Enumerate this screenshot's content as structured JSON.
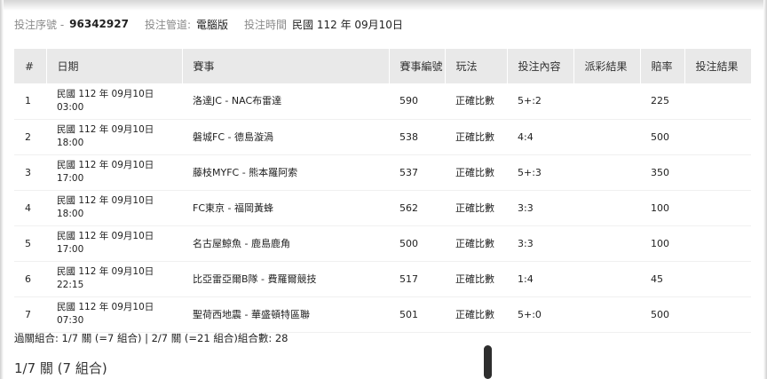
{
  "info": {
    "serial_label": "投注序號 -",
    "serial_value": "96342927",
    "channel_label": "投注管道:",
    "channel_value": "電腦版",
    "time_label": "投注時間",
    "time_value": "民國 112 年 09月10日"
  },
  "table": {
    "headers": [
      "#",
      "日期",
      "賽事",
      "賽事編號",
      "玩法",
      "投注內容",
      "派彩結果",
      "賠率",
      "投注結果"
    ],
    "rows": [
      {
        "no": "1",
        "date": "民國 112 年 09月10日",
        "time": "03:00",
        "match": "洛達JC - NAC布雷達",
        "match_id": "590",
        "play": "正確比數",
        "pick": "5+:2",
        "payout": "",
        "odds": "225",
        "result": ""
      },
      {
        "no": "2",
        "date": "民國 112 年 09月10日",
        "time": "18:00",
        "match": "磐城FC - 德島漩渦",
        "match_id": "538",
        "play": "正確比數",
        "pick": "4:4",
        "payout": "",
        "odds": "500",
        "result": ""
      },
      {
        "no": "3",
        "date": "民國 112 年 09月10日",
        "time": "17:00",
        "match": "藤枝MYFC - 熊本羅阿索",
        "match_id": "537",
        "play": "正確比數",
        "pick": "5+:3",
        "payout": "",
        "odds": "350",
        "result": ""
      },
      {
        "no": "4",
        "date": "民國 112 年 09月10日",
        "time": "18:00",
        "match": "FC東京 - 福岡黃蜂",
        "match_id": "562",
        "play": "正確比數",
        "pick": "3:3",
        "payout": "",
        "odds": "100",
        "result": ""
      },
      {
        "no": "5",
        "date": "民國 112 年 09月10日",
        "time": "17:00",
        "match": "名古屋鯨魚 - 鹿島鹿角",
        "match_id": "500",
        "play": "正確比數",
        "pick": "3:3",
        "payout": "",
        "odds": "100",
        "result": ""
      },
      {
        "no": "6",
        "date": "民國 112 年 09月10日",
        "time": "22:15",
        "match": "比亞雷亞爾B隊 - 費羅爾競技",
        "match_id": "517",
        "play": "正確比數",
        "pick": "1:4",
        "payout": "",
        "odds": "45",
        "result": ""
      },
      {
        "no": "7",
        "date": "民國 112 年 09月10日",
        "time": "07:30",
        "match": "聖荷西地震 - 華盛頓特區聯",
        "match_id": "501",
        "play": "正確比數",
        "pick": "5+:0",
        "payout": "",
        "odds": "500",
        "result": ""
      }
    ]
  },
  "summary": "過關組合: 1/7 關 (=7 組合) | 2/7 關 (=21 組合)組合數: 28",
  "section_title": "1/7 關 (7 組合)"
}
